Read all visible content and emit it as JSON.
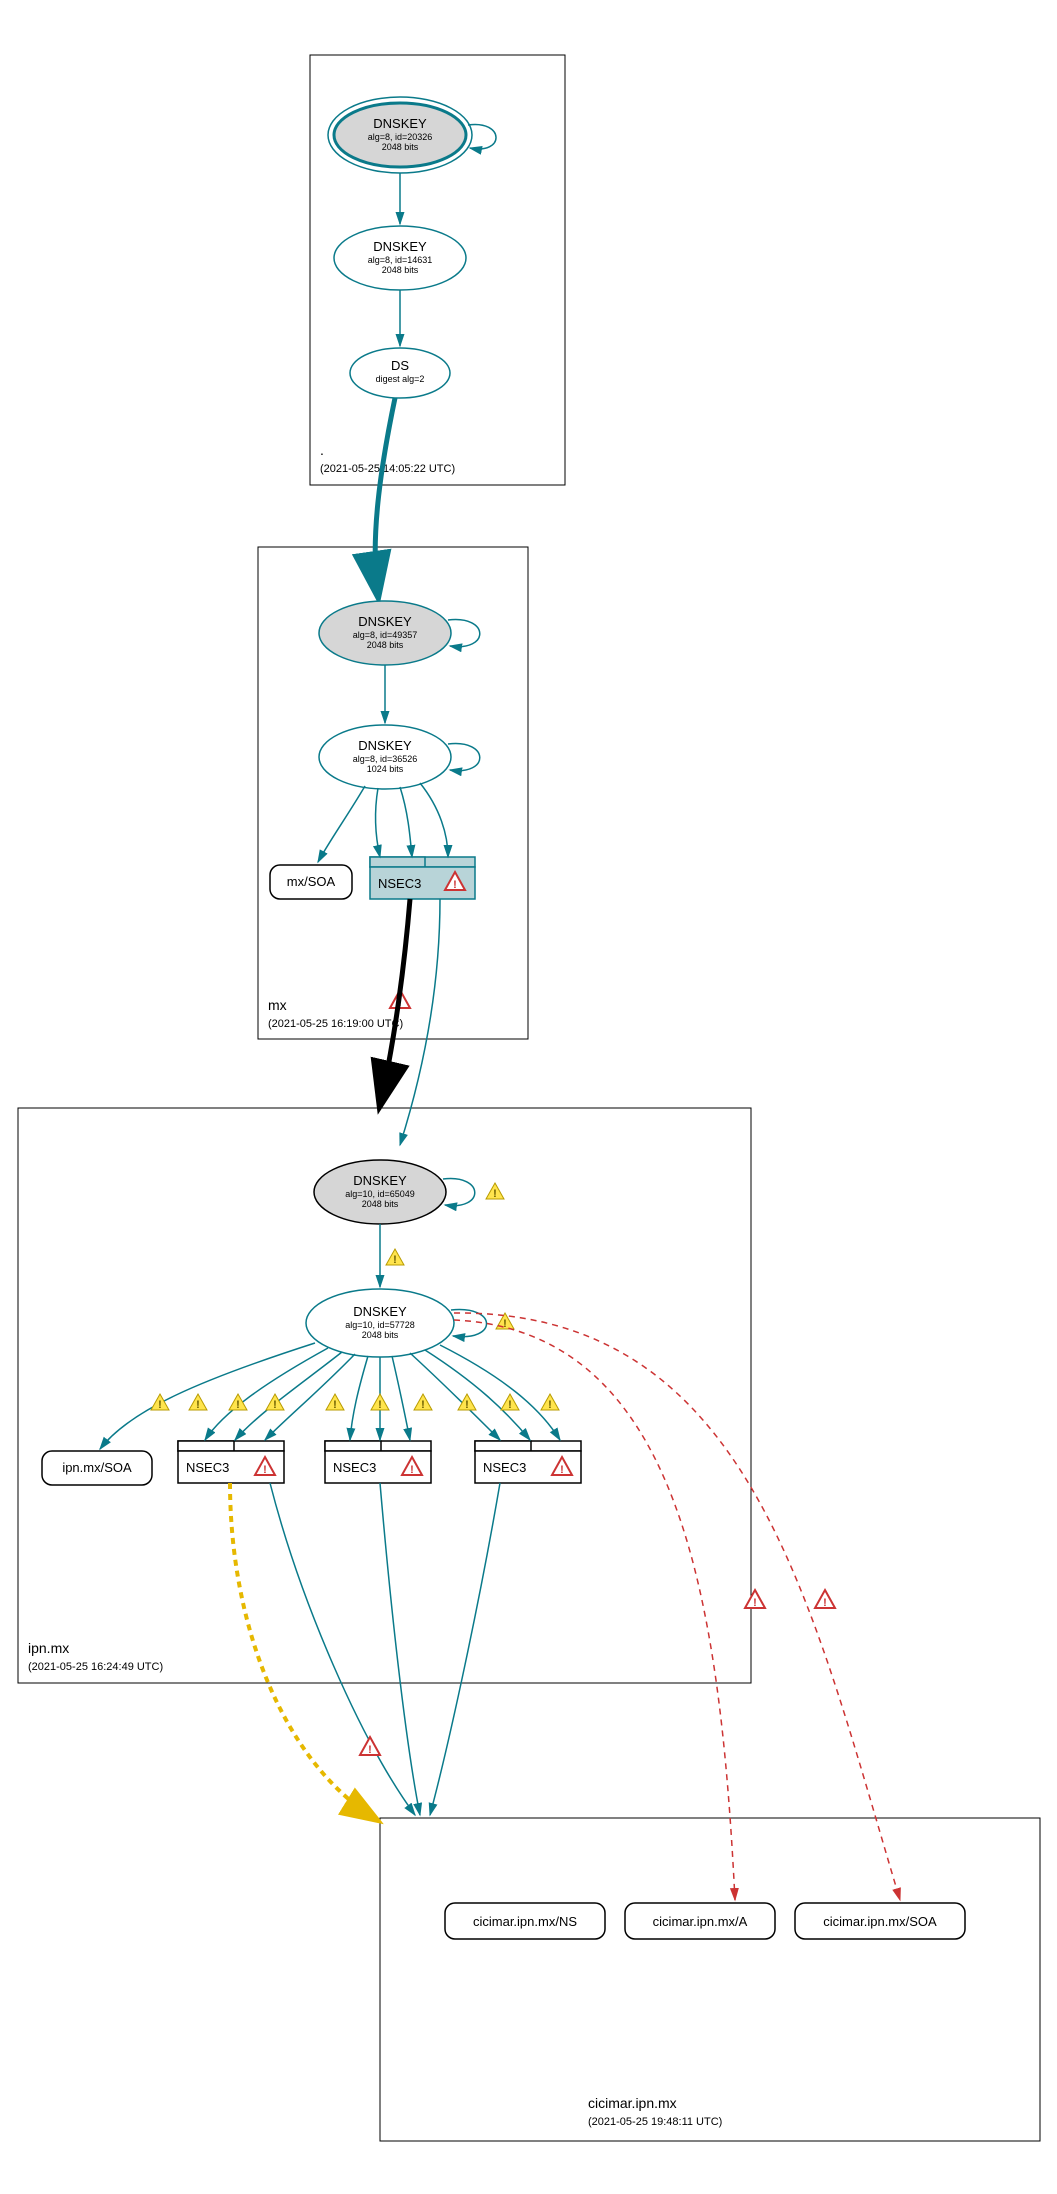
{
  "colors": {
    "teal": "#0a7a8a",
    "grey": "#d6d6d6",
    "yellow": "#e6b800",
    "red": "#cc3333"
  },
  "zones": {
    "root": {
      "label": ".",
      "timestamp": "(2021-05-25 14:05:22 UTC)"
    },
    "mx": {
      "label": "mx",
      "timestamp": "(2021-05-25 16:19:00 UTC)"
    },
    "ipn": {
      "label": "ipn.mx",
      "timestamp": "(2021-05-25 16:24:49 UTC)"
    },
    "cicimar": {
      "label": "cicimar.ipn.mx",
      "timestamp": "(2021-05-25 19:48:11 UTC)"
    }
  },
  "nodes": {
    "root_ksk": {
      "title": "DNSKEY",
      "sub1": "alg=8, id=20326",
      "sub2": "2048 bits"
    },
    "root_zsk": {
      "title": "DNSKEY",
      "sub1": "alg=8, id=14631",
      "sub2": "2048 bits"
    },
    "root_ds": {
      "title": "DS",
      "sub1": "digest alg=2"
    },
    "mx_ksk": {
      "title": "DNSKEY",
      "sub1": "alg=8, id=49357",
      "sub2": "2048 bits"
    },
    "mx_zsk": {
      "title": "DNSKEY",
      "sub1": "alg=8, id=36526",
      "sub2": "1024 bits"
    },
    "mx_soa": {
      "label": "mx/SOA"
    },
    "mx_nsec": {
      "label": "NSEC3"
    },
    "ipn_ksk": {
      "title": "DNSKEY",
      "sub1": "alg=10, id=65049",
      "sub2": "2048 bits"
    },
    "ipn_zsk": {
      "title": "DNSKEY",
      "sub1": "alg=10, id=57728",
      "sub2": "2048 bits"
    },
    "ipn_soa": {
      "label": "ipn.mx/SOA"
    },
    "ipn_nsec1": {
      "label": "NSEC3"
    },
    "ipn_nsec2": {
      "label": "NSEC3"
    },
    "ipn_nsec3": {
      "label": "NSEC3"
    },
    "cic_ns": {
      "label": "cicimar.ipn.mx/NS"
    },
    "cic_a": {
      "label": "cicimar.ipn.mx/A"
    },
    "cic_soa": {
      "label": "cicimar.ipn.mx/SOA"
    }
  },
  "icons": {
    "warning": "!",
    "error": "!"
  }
}
